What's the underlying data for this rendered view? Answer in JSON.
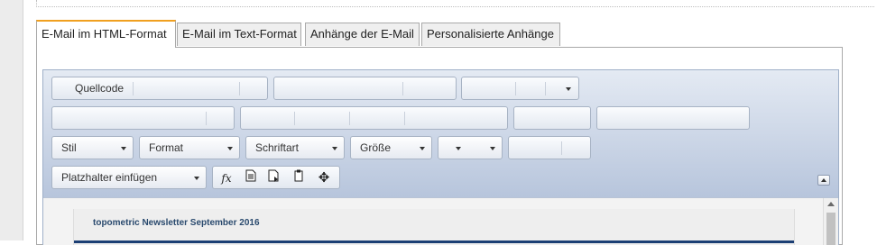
{
  "tabs": [
    {
      "label": "E-Mail im HTML-Format",
      "active": true
    },
    {
      "label": "E-Mail im Text-Format",
      "active": false
    },
    {
      "label": "Anhänge der E-Mail",
      "active": false
    },
    {
      "label": "Personalisierte Anhänge",
      "active": false
    }
  ],
  "toolbar": {
    "source_label": "Quellcode",
    "style_label": "Stil",
    "format_label": "Format",
    "font_label": "Schriftart",
    "size_label": "Größe",
    "color_label": "",
    "placeholder_label": "Platzhalter einfügen",
    "icons": [
      "formula-icon",
      "document-icon",
      "document-export-icon",
      "clipboard-icon",
      "move-icon"
    ]
  },
  "content": {
    "newsletter_title": "topometric Newsletter September 2016"
  }
}
